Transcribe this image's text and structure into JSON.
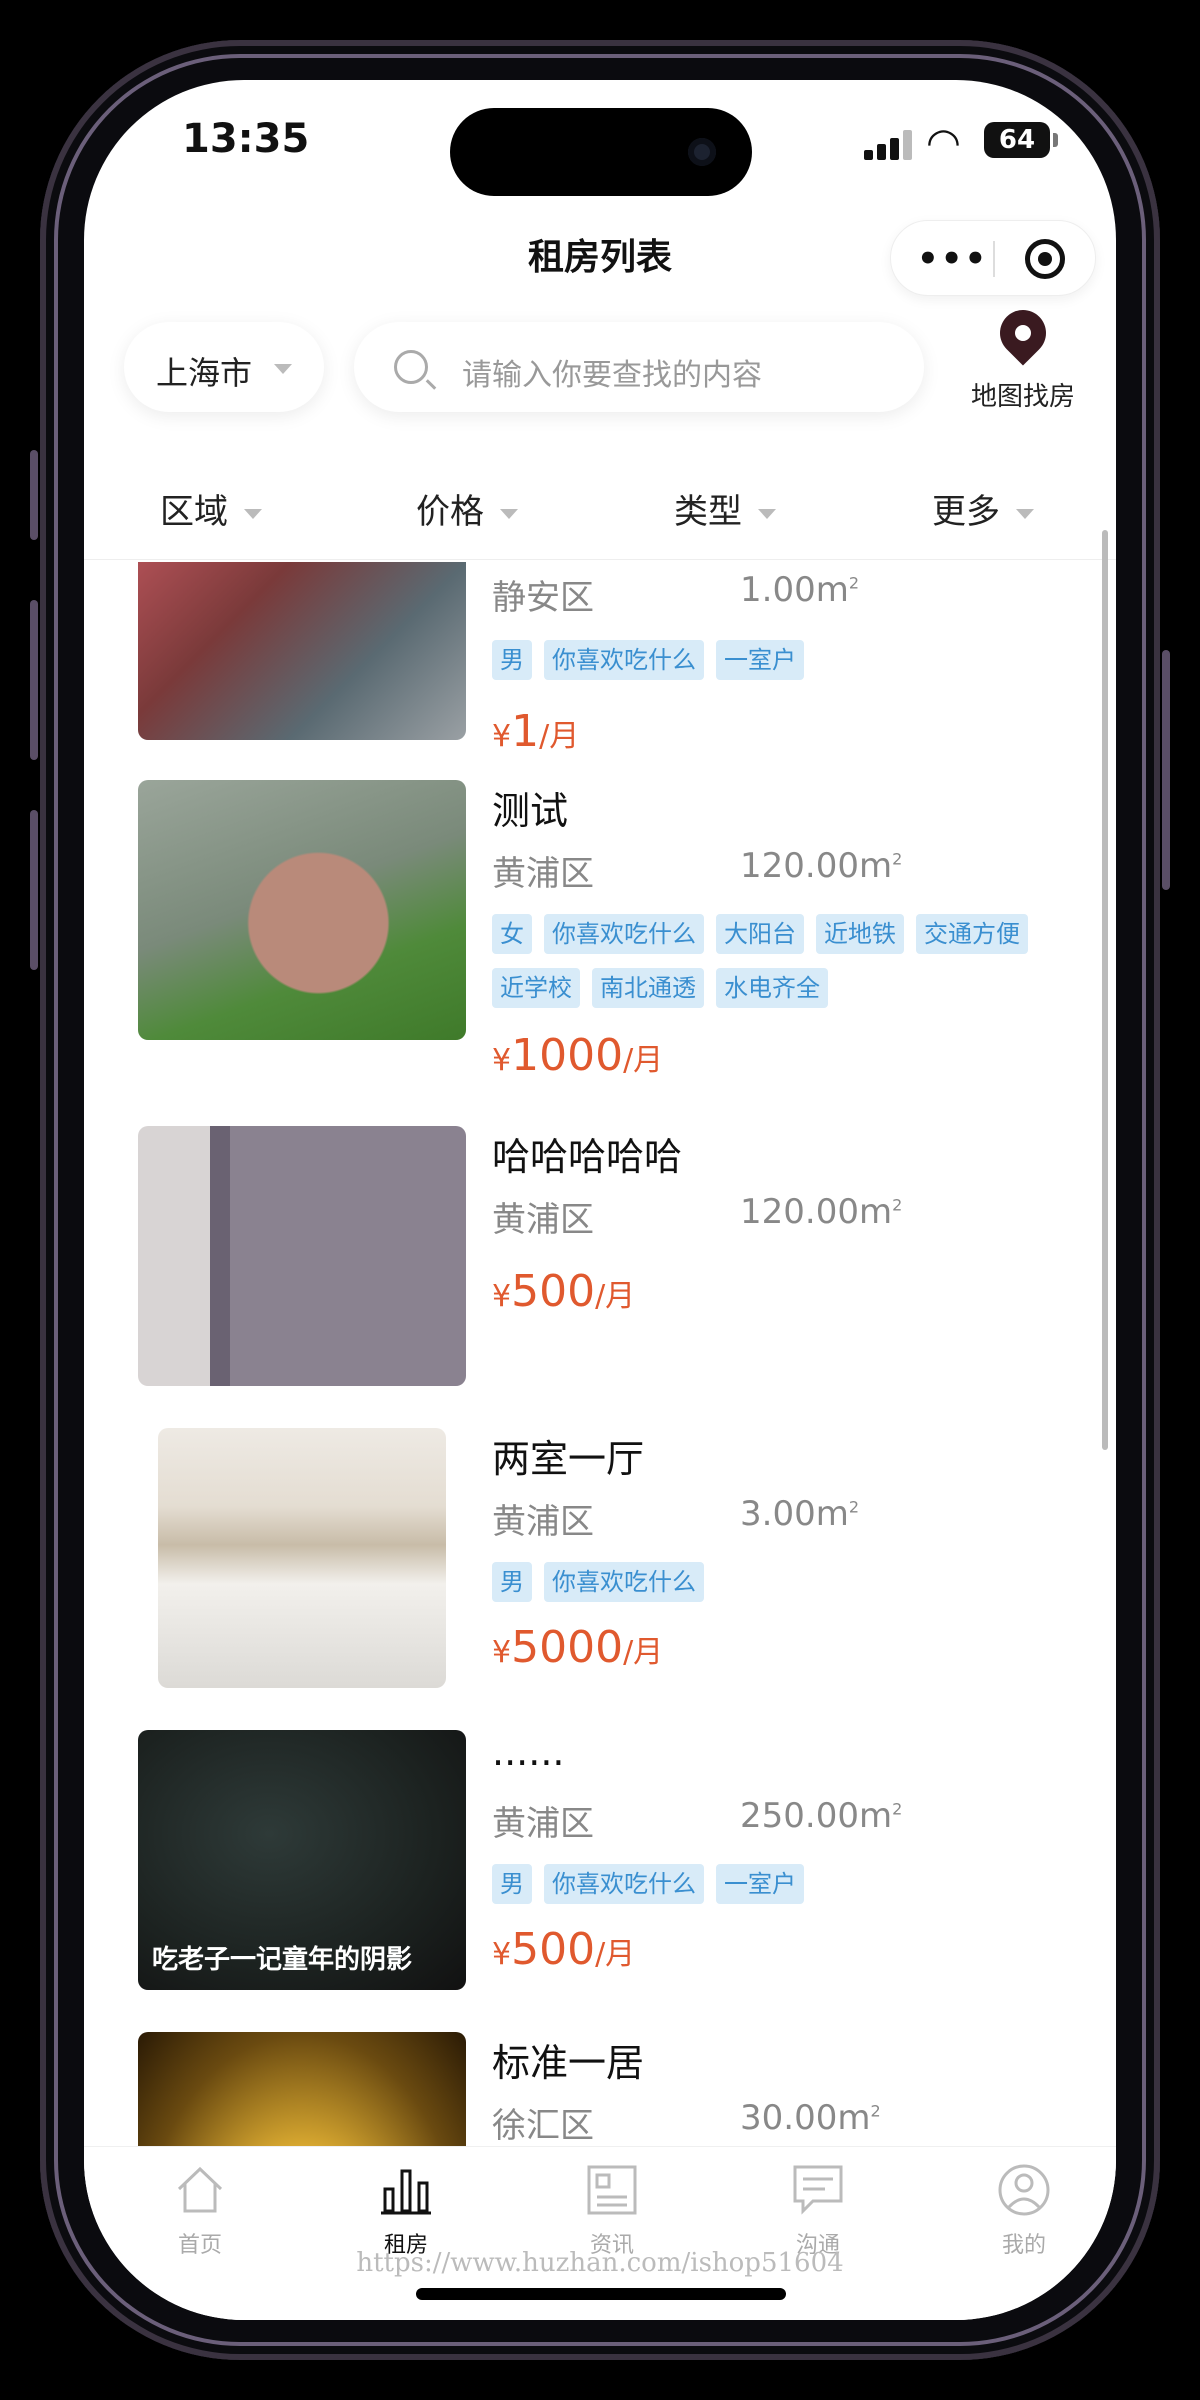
{
  "status": {
    "time": "13:35",
    "battery": "64"
  },
  "header": {
    "title": "租房列表"
  },
  "search": {
    "city": "上海市",
    "placeholder": "请输入你要查找的内容",
    "map_label": "地图找房"
  },
  "filters": [
    "区域",
    "价格",
    "类型",
    "更多"
  ],
  "listings": [
    {
      "name": "",
      "district": "静安区",
      "area": "1.00m",
      "tags": [
        "男",
        "你喜欢吃什么",
        "一室户"
      ],
      "price_currency": "¥",
      "price_amount": "1",
      "price_unit": "/月"
    },
    {
      "name": "测试",
      "district": "黄浦区",
      "area": "120.00m",
      "tags": [
        "女",
        "你喜欢吃什么",
        "大阳台",
        "近地铁",
        "交通方便",
        "近学校",
        "南北通透",
        "水电齐全"
      ],
      "price_currency": "¥",
      "price_amount": "1000",
      "price_unit": "/月"
    },
    {
      "name": "哈哈哈哈哈",
      "district": "黄浦区",
      "area": "120.00m",
      "tags": [],
      "price_currency": "¥",
      "price_amount": "500",
      "price_unit": "/月"
    },
    {
      "name": "两室一厅",
      "district": "黄浦区",
      "area": "3.00m",
      "tags": [
        "男",
        "你喜欢吃什么"
      ],
      "price_currency": "¥",
      "price_amount": "5000",
      "price_unit": "/月"
    },
    {
      "name": "......",
      "district": "黄浦区",
      "area": "250.00m",
      "tags": [
        "男",
        "你喜欢吃什么",
        "一室户"
      ],
      "price_currency": "¥",
      "price_amount": "500",
      "price_unit": "/月",
      "image_caption": "吃老子一记童年的阴影"
    },
    {
      "name": "标准一居",
      "district": "徐汇区",
      "area": "30.00m",
      "tags": [],
      "price_currency": "",
      "price_amount": "",
      "price_unit": ""
    }
  ],
  "area_unit_sup": "2",
  "tabbar": [
    {
      "label": "首页",
      "icon": "home-icon",
      "active": false
    },
    {
      "label": "租房",
      "icon": "bar-chart-icon",
      "active": true
    },
    {
      "label": "资讯",
      "icon": "news-icon",
      "active": false
    },
    {
      "label": "沟通",
      "icon": "message-icon",
      "active": false
    },
    {
      "label": "我的",
      "icon": "user-icon",
      "active": false
    }
  ],
  "watermark": "https://www.huzhan.com/ishop51604",
  "colors": {
    "price": "#e0592e",
    "tag_bg": "#d8ebf8",
    "tag_text": "#3a8fd0"
  }
}
